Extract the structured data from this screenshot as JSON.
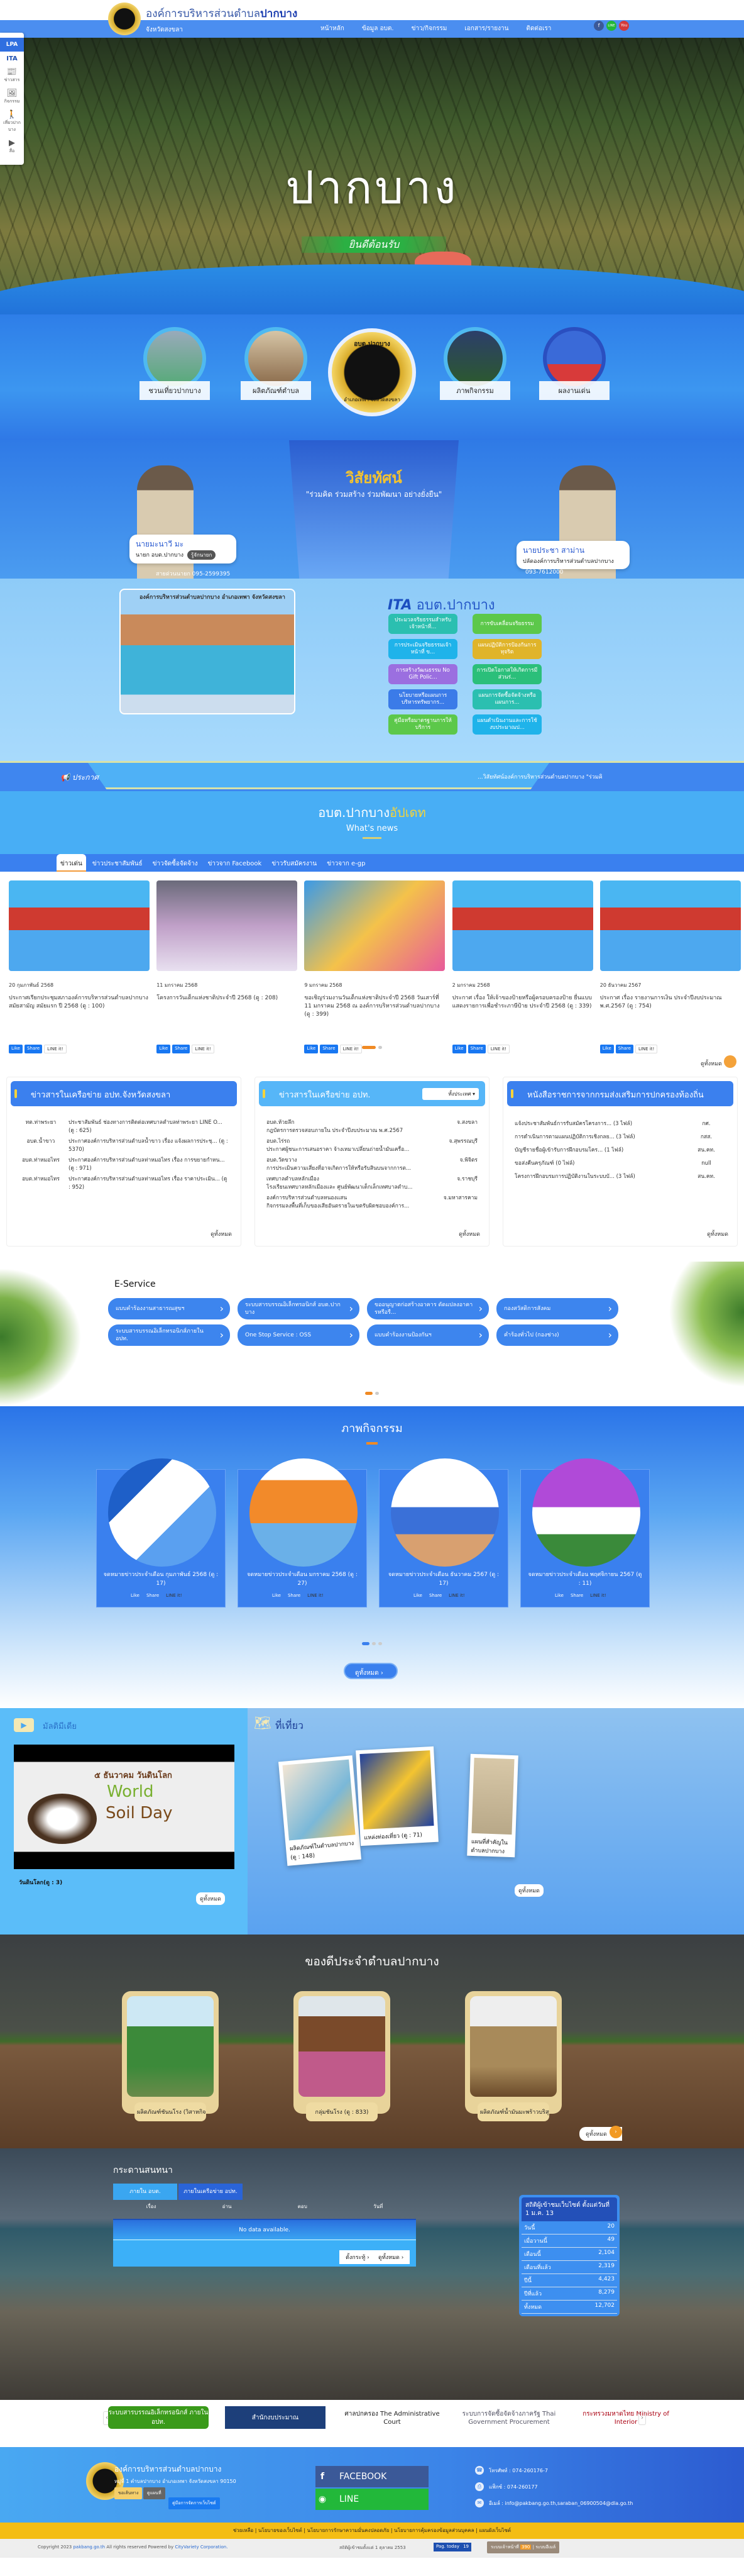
{
  "header": {
    "org_prefix": "องค์การบริหารส่วนตำบล",
    "org_name": "ปากบาง",
    "province": "จังหวัดสงขลา",
    "nav": [
      "หน้าหลัก",
      "ข้อมูล อบต.",
      "ข่าว/กิจกรรม",
      "เอกสาร/รายงาน",
      "ติดต่อเรา"
    ],
    "social": [
      "f",
      "LINE",
      "You"
    ]
  },
  "side": {
    "lpa": "LPA",
    "ita": "ITA",
    "items": [
      {
        "icon": "📰",
        "label": "ข่าวสาร"
      },
      {
        "icon": "🖼",
        "label": "กิจกรรม"
      },
      {
        "icon": "🚶",
        "label": "เที่ยวปากบาง"
      },
      {
        "icon": "▶",
        "label": "สื่อ"
      }
    ]
  },
  "hero": {
    "title": "ปากบาง",
    "welcome": "ยินดีต้อนรับ"
  },
  "circles": {
    "items": [
      "ชวนเที่ยวปากบาง",
      "ผลิตภัณฑ์ตำบล",
      "ภาพกิจกรรม",
      "ผลงานเด่น"
    ],
    "seal_top": "อบต.ปากบาง",
    "seal_bottom": "อำเภอเทพา จังหวัดสงขลา"
  },
  "vision": {
    "title": "วิสัยทัศน์",
    "quote": "\"ร่วมคิด ร่วมสร้าง ร่วมพัฒนา อย่างยั่งยืน\"",
    "mayor": {
      "name": "นายมะนาวี มะ",
      "role": "นายก อบต.ปากบาง",
      "button": "รู้จักนายก",
      "phone": "สายด่วนนายก 095-2599395"
    },
    "clerk": {
      "name": "นายประชา สาม่าน",
      "role": "ปลัดองค์การบริหารส่วนตำบลปากบาง",
      "phone": "093-7612000"
    }
  },
  "ita": {
    "banner_text": "องค์การบริหารส่วนตำบลปากบาง อำเภอเทพา จังหวัดสงขลา",
    "logo": "ITA",
    "title": "อบต.ปากบาง",
    "items": [
      {
        "label": "ประมวลจริยธรรมสำหรับเจ้าหน้าที่...",
        "color": "#2bbfb0"
      },
      {
        "label": "การขับเคลื่อนจริยธรรม",
        "color": "#5cc84a"
      },
      {
        "label": "การประเมินจริยธรรมเจ้าหน้าที่ ข...",
        "color": "#1fb3ea"
      },
      {
        "label": "แผนปฏิบัติการป้องกันการทุจริต",
        "color": "#e0b42a"
      },
      {
        "label": "การสร้างวัฒนธรรม No Gift Polic...",
        "color": "#9b6fe0"
      },
      {
        "label": "การเปิดโอกาสให้เกิดการมีส่วนร่...",
        "color": "#2bbf7a"
      },
      {
        "label": "นโยบายหรือแผนการบริหารทรัพยากร...",
        "color": "#3b7be8"
      },
      {
        "label": "แผนการจัดซื้อจัดจ้างหรือแผนการ...",
        "color": "#2bbfb0"
      },
      {
        "label": "คู่มือหรือมาตรฐานการให้บริการ",
        "color": "#5cc84a"
      },
      {
        "label": "แผนดำเนินงานและการใช้งบประมาณป...",
        "color": "#1fb3ea"
      }
    ]
  },
  "announce": {
    "label": "ประกาศ",
    "text": "...วิสัยทัศน์องค์การบริหารส่วนตำบลปากบาง \"ร่วมคิ"
  },
  "whats": {
    "title_a": "อบต.ปากบาง",
    "title_b": "อัปเดท",
    "subtitle": "What's news"
  },
  "news_tabs": [
    "ข่าวเด่น",
    "ข่าวประชาสัมพันธ์",
    "ข่าวจัดซื้อจัดจ้าง",
    "ข่าวจาก Facebook",
    "ข่าวรับสมัครงาน",
    "ข่าวจาก e-gp"
  ],
  "news": [
    {
      "date": "20 กุมภาพันธ์ 2568",
      "title": "ประกาศเรียกประชุมสภาองค์การบริหารส่วนตำบลปากบาง สมัยสามัญ สมัยแรก ปี 2568 (ดู : 100)"
    },
    {
      "date": "11 มกราคม 2568",
      "title": "โครงการวันเด็กแห่งชาติประจำปี 2568 (ดู : 208)"
    },
    {
      "date": "9 มกราคม 2568",
      "title": "ขอเชิญร่วมงานวันเด็กแห่งชาติประจำปี 2568 วันเสาร์ที่ 11 มกราคม 2568 ณ องค์การบริหารส่วนตำบลปากบาง (ดู : 399)"
    },
    {
      "date": "2 มกราคม 2568",
      "title": "ประกาศ เรื่อง ให้เจ้าของป้ายหรือผู้ครอบครองป้าย ยื่นแบบแสดงรายการเพื่อชำระภาษีป้าย ประจำปี 2568 (ดู : 339)"
    },
    {
      "date": "20 ธันวาคม 2567",
      "title": "ประกาศ เรื่อง รายงานการเงิน ประจำปีงบประมาณ พ.ศ.2567 (ดู : 754)"
    }
  ],
  "share": {
    "like": "Like",
    "share": "Share",
    "line": "LINE it!"
  },
  "see_all": "ดูทั้งหมด",
  "network_songkhla": {
    "title": "ข่าวสารในเครือข่าย อปท.จังหวัดสงขลา",
    "rows": [
      {
        "org": "ทต.ท่าพระยา",
        "text": "ประชาสัมพันธ์ ช่องทางการติดต่อเทศบาลตำบลท่าพระยา LINE O... (ดู : 625)"
      },
      {
        "org": "อบต.น้ำขาว",
        "text": "ประกาศองค์การบริหารส่วนตำบลน้ำขาว เรื่อง แจ้งผลการประชุ... (ดู : 5370)"
      },
      {
        "org": "อบต.ท่าหมอไทร",
        "text": "ประกาศองค์การบริหารส่วนตำบลท่าหมอไทร เรื่อง การขยายกำหน... (ดู : 971)"
      },
      {
        "org": "อบต.ท่าหมอไทร",
        "text": "ประกาศองค์การบริหารส่วนตำบลท่าหมอไทร เรื่อง ราคาประเมิน... (ดู : 952)"
      }
    ]
  },
  "network_all": {
    "title": "ข่าวสารในเครือข่าย อปท.",
    "select": "ทั้งประเทศ",
    "rows": [
      {
        "org": "อบต.ห้วยลึก",
        "prov": "จ.สงขลา",
        "text": "กฎบัตรการตรวจสอบภายใน ประจำปีงบประมาณ พ.ศ.2567"
      },
      {
        "org": "อบต.ไร่รถ",
        "prov": "จ.สุพรรณบุรี",
        "text": "ประกาศผู้ชนะการเสนอราคา จ้างเหมาเปลี่ยนถ่ายน้ำมันเครื่อ..."
      },
      {
        "org": "อบต.วัดขวาง",
        "prov": "จ.พิจิตร",
        "text": "การประเมินความเสี่ยงที่อาจเกิดการให้หรือรับสินบนจากการต..."
      },
      {
        "org": "เทศบาลตำบลหลักเมือง",
        "prov": "จ.ราชบุรี",
        "text": "โรงเรียนเทศบาลหลักเมืองและ ศูนย์พัฒนาเด็กเล็กเทศบาลตำบ..."
      },
      {
        "org": "องค์การบริหารส่วนตำบลหนองแสน",
        "prov": "จ.มหาสารคาม",
        "text": "กิจกรรมลงพื้นที่เก็บของเสียอันตรายในเขตรับผิดชอบองค์การ..."
      }
    ]
  },
  "dla_letters": {
    "title": "หนังสือราชการจากกรมส่งเสริมการปกครองท้องถิ่น",
    "rows": [
      {
        "text": "แจ้งประชาสัมพันธ์การรับสมัครโครงการ... (3 ไฟล์)",
        "dept": "กศ."
      },
      {
        "text": "การดำเนินการตามแผนปฏิบัติการเชิงกลย... (3 ไฟล์)",
        "dept": "กสส."
      },
      {
        "text": "บัญชีรายชื่อผู้เข้ารับการฝึกอบรมโคร... (1 ไฟล์)",
        "dept": "สน.คท."
      },
      {
        "text": "ขอส่งคืนครุภัณฑ์ (0 ไฟล์)",
        "dept": "null"
      },
      {
        "text": "โครงการฝึกอบรมการปฏิบัติงานในระบบบั... (3 ไฟล์)",
        "dept": "สน.คท."
      }
    ]
  },
  "eservice": {
    "title": "E-Service",
    "items": [
      "แบบคำร้องงานสาธารณสุขฯ",
      "ระบบสารบรรณอิเล็กทรอนิกส์ อบต.ปากบาง",
      "ขออนุญาตก่อสร้างอาคาร ดัดแปลงอาคารหรือรื...",
      "กองสวัสดิการสังคม",
      "ระบบสารบรรณอิเล็กทรอนิกส์ภายใน อปท.",
      "One Stop Service : OSS",
      "แบบคำร้องงานป้องกันฯ",
      "คำร้องทั่วไป (กองช่าง)"
    ]
  },
  "activities": {
    "title": "ภาพกิจกรรม",
    "more": "ดูทั้งหมด",
    "items": [
      "จดหมายข่าวประจำเดือน กุมภาพันธ์ 2568 (ดู : 17)",
      "จดหมายข่าวประจำเดือน มกราคม 2568 (ดู : 27)",
      "จดหมายข่าวประจำเดือน ธันวาคม 2567 (ดู : 17)",
      "จดหมายข่าวประจำเดือน พฤศจิกายน 2567 (ดู : 11)"
    ]
  },
  "multimedia": {
    "title": "มัลติมีเดีย",
    "video_th": "๕ ธันวาคม วันดินโลก",
    "video_w": "World",
    "video_s": "Soil Day",
    "caption": "วันดินโลก(ดู : 3)",
    "more": "ดูทั้งหมด"
  },
  "tourism": {
    "title": "ที่เที่ยว",
    "more": "ดูทั้งหมด",
    "items": [
      "ผลิตภัณฑ์ในตำบลปากบาง (ดู : 148)",
      "แหล่งท่องเที่ยว (ดู : 71)",
      "แผนที่สำคัญในตำบลปากบาง (ดู : 142)"
    ]
  },
  "products": {
    "title": "ของดีประจำตำบลปากบาง",
    "more": "ดูทั้งหมด",
    "items": [
      "ผลิตภัณฑ์ชันนโรง (วิสาหกิจชุมช...",
      "กลุ่มชันโรง (ดู : 833)",
      "ผลิตภัณฑ์น้ำมันมะพร้าวบริสุทธิ์บ้..."
    ]
  },
  "forum": {
    "title": "กระดานสนทนา",
    "tabs": [
      "ภายใน อบต.",
      "ภายในเครือข่าย อปท."
    ],
    "columns": [
      "เรื่อง",
      "อ่าน",
      "ตอบ",
      "วันที่"
    ],
    "empty": "No data available.",
    "new_topic": "ตั้งกระทู้",
    "more": "ดูทั้งหมด"
  },
  "stats": {
    "title": "สถิติผู้เข้าชมเว็บไซต์ ตั้งแต่วันที่ 1 ม.ค. 13",
    "rows": [
      {
        "label": "วันนี้",
        "value": "20"
      },
      {
        "label": "เมื่อวานนี้",
        "value": "49"
      },
      {
        "label": "เดือนนี้",
        "value": "2,104"
      },
      {
        "label": "เดือนที่แล้ว",
        "value": "2,319"
      },
      {
        "label": "ปีนี้",
        "value": "4,423"
      },
      {
        "label": "ปีที่แล้ว",
        "value": "8,279"
      },
      {
        "label": "ทั้งหมด",
        "value": "12,702"
      }
    ]
  },
  "partners": [
    "ระบบสารบรรณอิเล็กทรอนิกส์ ภายใน อปท.",
    "สำนักงบประมาณ",
    "ศาลปกครอง The Administrative Court",
    "ระบบการจัดซื้อจัดจ้างภาครัฐ Thai Government Procurement",
    "กระทรวงมหาดไทย Ministry of Interior"
  ],
  "footer": {
    "name": "องค์การบริหารส่วนตำบลปากบาง",
    "address": "หมู่ที่ 1 ตำบลปากบาง อำเภอเทพา จังหวัดสงขลา 90150",
    "buttons": [
      "ขอเส้นทาง",
      "ดูแผนที่",
      "คู่มือการจัดการเว็บไซต์"
    ],
    "facebook": "FACEBOOK",
    "line": "LINE",
    "phone": "โทรศัพท์ : 074-260176-7",
    "fax": "แฟ็กซ์ : 074-260177",
    "email": "อีเมล์ : info@pakbang.go.th,saraban_06900504@dla.go.th",
    "links": "ช่วยเหลือ | นโยบายของเว็บไซต์ | นโยบายการรักษาความมั่นคงปลอดภัย | นโยบายการคุ้มครองข้อมูลส่วนบุคคล | แผนผังเว็บไซต์",
    "copyright_a": "Copyright 2023 ",
    "copyright_site": "pakbang.go.th",
    "copyright_b": " All rights reserved Powered by ",
    "copyright_co": "CityVariety Corporation.",
    "visitors": "สถิติผู้เข้าชมตั้งแต่ 1 ตุลาคม 2553",
    "page_today": "Pag. today",
    "page_today_val": "19",
    "staff": "ระบบเจ้าหน้าที่",
    "staff_count": "390",
    "email_sys": "ระบบอีเมล์"
  }
}
